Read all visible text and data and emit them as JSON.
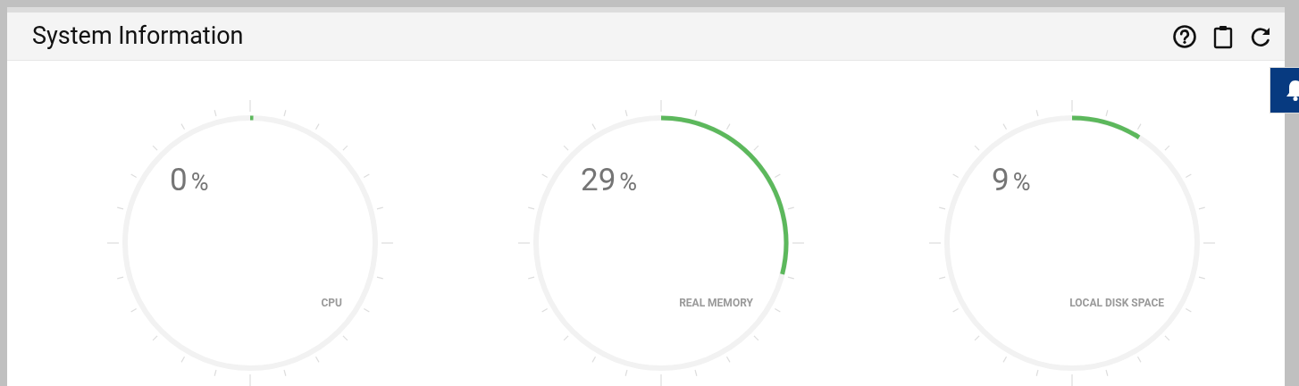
{
  "panel": {
    "title": "System Information"
  },
  "gauges": [
    {
      "value": "0",
      "unit": "%",
      "label": "CPU"
    },
    {
      "value": "29",
      "unit": "%",
      "label": "REAL MEMORY"
    },
    {
      "value": "9",
      "unit": "%",
      "label": "LOCAL DISK SPACE"
    }
  ]
}
